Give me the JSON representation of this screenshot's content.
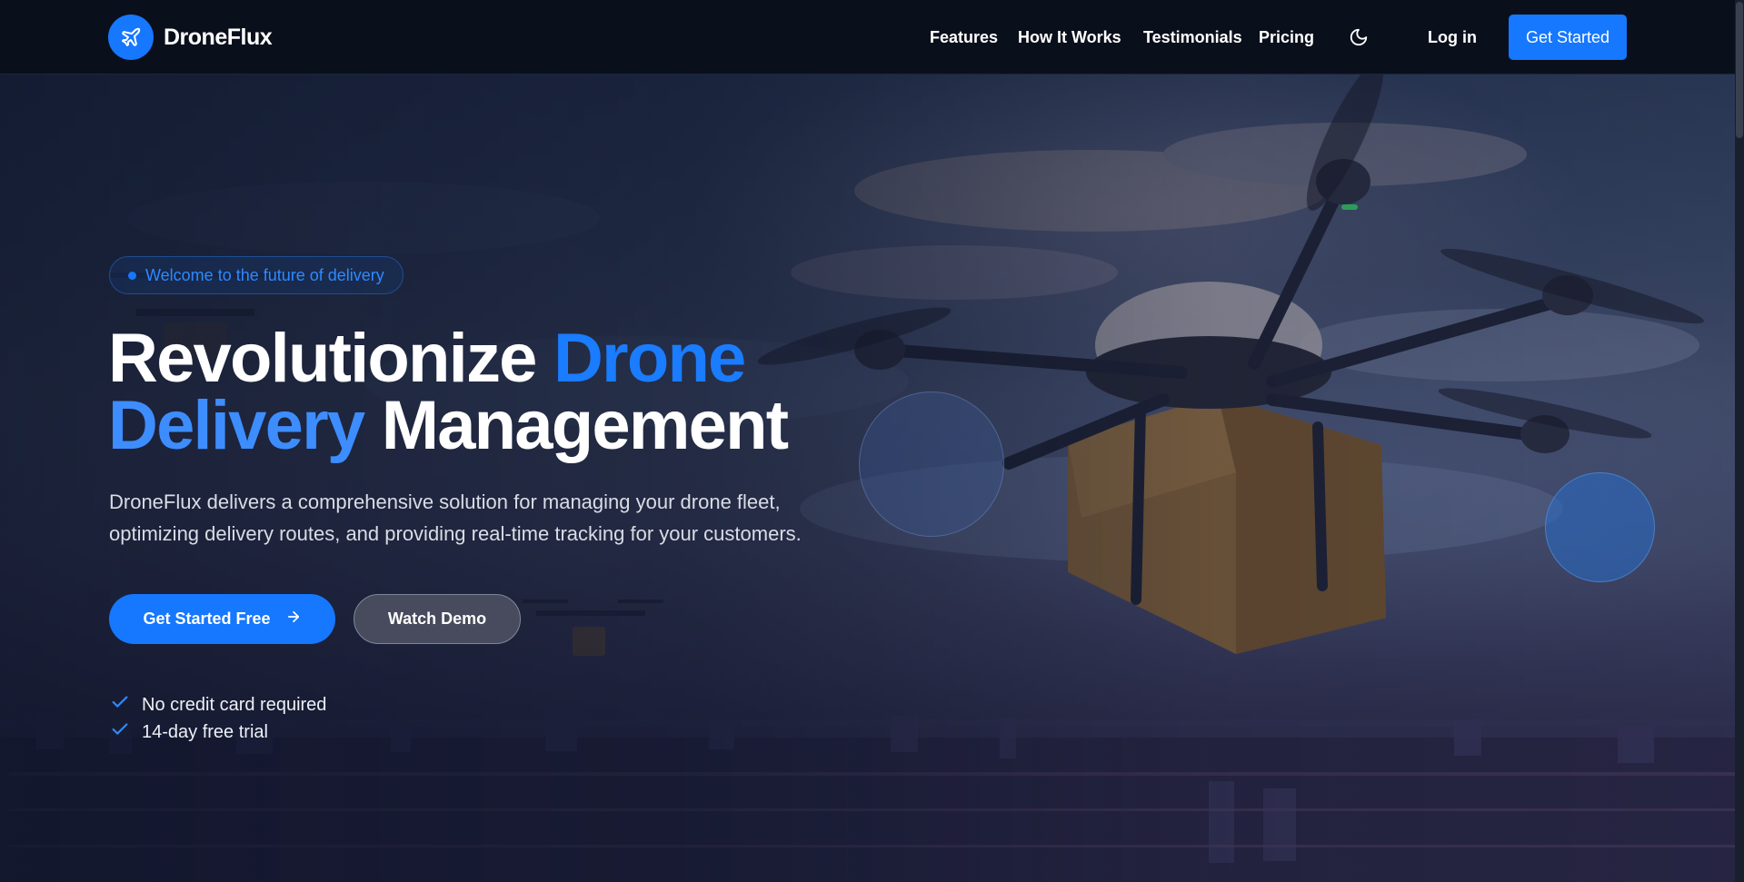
{
  "header": {
    "brand": "DroneFlux",
    "nav": [
      "Features",
      "How It Works",
      "Testimonials",
      "Pricing"
    ],
    "login_label": "Log in",
    "cta_label": "Get Started"
  },
  "hero": {
    "badge": "Welcome to the future of delivery",
    "headline": {
      "part1": "Revolutionize ",
      "part2": "Drone",
      "part3": "Delivery",
      "part4": " Management"
    },
    "subtitle_line1": "DroneFlux delivers a comprehensive solution for managing your drone fleet,",
    "subtitle_line2": "optimizing delivery routes, and providing real-time tracking for your customers.",
    "primary_button": "Get Started Free",
    "secondary_button": "Watch Demo",
    "perks": [
      "No credit card required",
      "14-day free trial"
    ]
  },
  "icons": {
    "logo": "airplane-icon",
    "theme": "moon-icon",
    "arrow": "arrow-right-icon",
    "check": "check-icon"
  },
  "colors": {
    "accent": "#1677ff",
    "header_bg": "#0a0f1c",
    "badge_text": "#2f89ff"
  }
}
